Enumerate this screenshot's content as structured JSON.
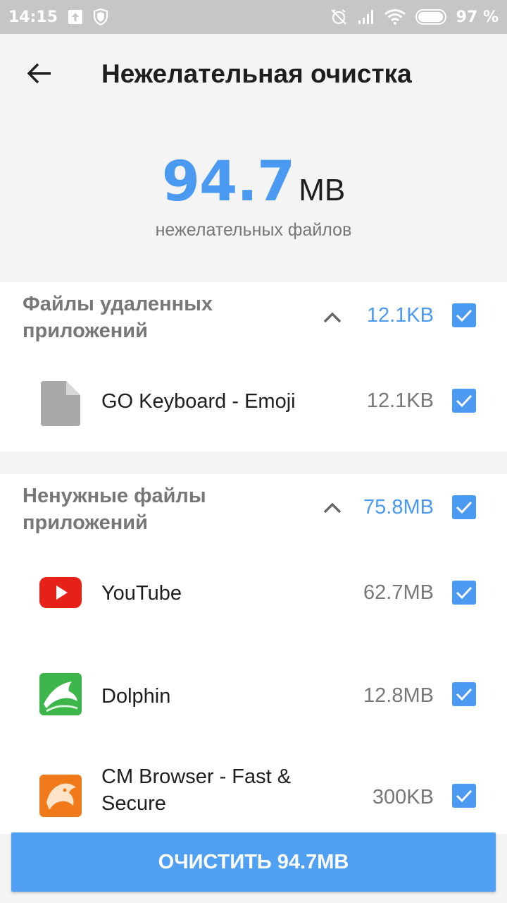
{
  "status_bar": {
    "time": "14:15",
    "battery_text": "97 %",
    "battery_level": 0.97
  },
  "header": {
    "title": "Нежелательная очистка",
    "total_value": "94.7",
    "total_unit": "MB",
    "total_label": "нежелательных файлов"
  },
  "sections": [
    {
      "title": "Файлы удаленных приложений",
      "size": "12.1KB",
      "items": [
        {
          "name": "GO Keyboard - Emoji",
          "size": "12.1KB",
          "icon": "file-icon"
        }
      ]
    },
    {
      "title": "Ненужные файлы приложений",
      "size": "75.8MB",
      "items": [
        {
          "name": "YouTube",
          "size": "62.7MB",
          "icon": "youtube-icon"
        },
        {
          "name": "Dolphin",
          "size": "12.8MB",
          "icon": "dolphin-icon"
        },
        {
          "name": "CM Browser - Fast & Secure",
          "size": "300KB",
          "icon": "cm-browser-icon"
        }
      ]
    }
  ],
  "clean_button": {
    "label": "ОЧИСТИТЬ 94.7MB"
  },
  "colors": {
    "accent": "#4a9af2",
    "status_bar": "#c6c6c6",
    "youtube_red": "#e62117",
    "dolphin_green": "#3cb54a",
    "cm_orange": "#f07a1a"
  }
}
